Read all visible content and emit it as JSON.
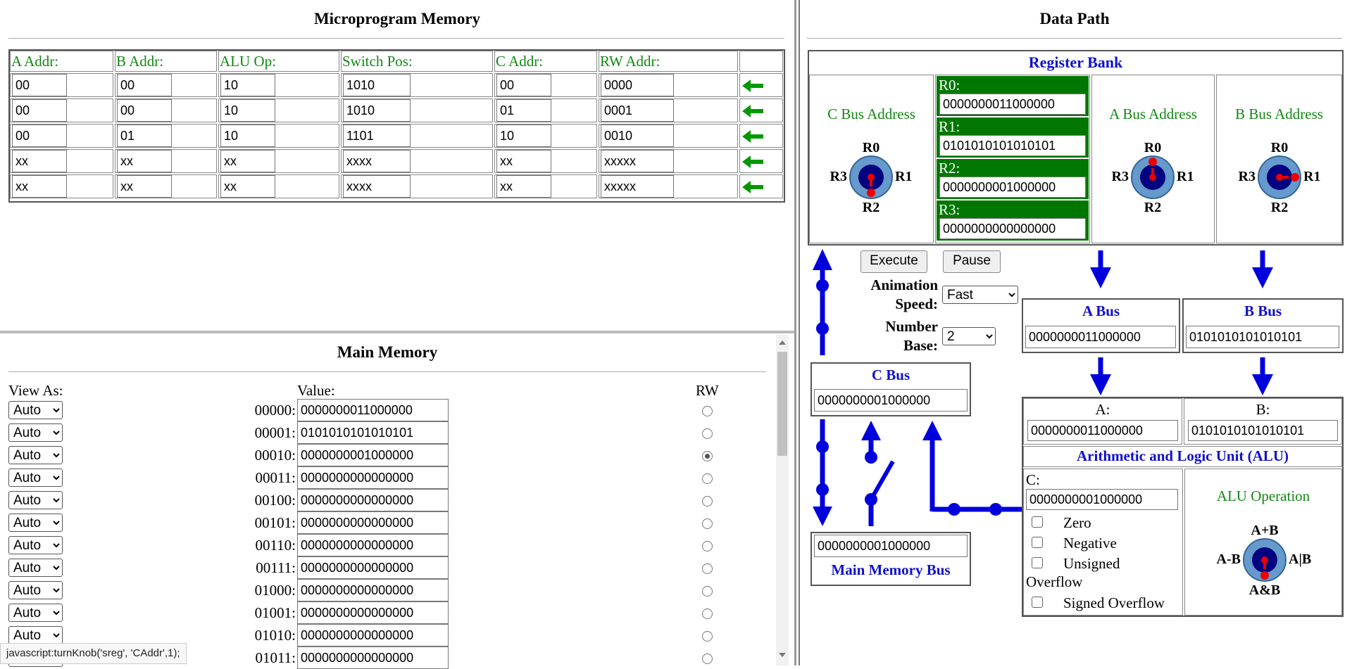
{
  "micro": {
    "title": "Microprogram Memory",
    "headers": [
      "A Addr:",
      "B Addr:",
      "ALU Op:",
      "Switch Pos:",
      "C Addr:",
      "RW Addr:"
    ],
    "rows": [
      [
        "00",
        "00",
        "10",
        "1010",
        "00",
        "0000"
      ],
      [
        "00",
        "00",
        "10",
        "1010",
        "01",
        "0001"
      ],
      [
        "00",
        "01",
        "10",
        "1101",
        "10",
        "0010"
      ],
      [
        "xx",
        "xx",
        "xx",
        "xxxx",
        "xx",
        "xxxxx"
      ],
      [
        "xx",
        "xx",
        "xx",
        "xxxx",
        "xx",
        "xxxxx"
      ]
    ],
    "arrow_color": "#009900"
  },
  "main": {
    "title": "Main Memory",
    "view_as_label": "View As:",
    "value_label": "Value:",
    "rw_label": "RW",
    "view_option": "Auto",
    "rows": [
      {
        "addr": "00000:",
        "value": "0000000011000000",
        "rw": false
      },
      {
        "addr": "00001:",
        "value": "0101010101010101",
        "rw": false
      },
      {
        "addr": "00010:",
        "value": "0000000001000000",
        "rw": true
      },
      {
        "addr": "00011:",
        "value": "0000000000000000",
        "rw": false
      },
      {
        "addr": "00100:",
        "value": "0000000000000000",
        "rw": false
      },
      {
        "addr": "00101:",
        "value": "0000000000000000",
        "rw": false
      },
      {
        "addr": "00110:",
        "value": "0000000000000000",
        "rw": false
      },
      {
        "addr": "00111:",
        "value": "0000000000000000",
        "rw": false
      },
      {
        "addr": "01000:",
        "value": "0000000000000000",
        "rw": false
      },
      {
        "addr": "01001:",
        "value": "0000000000000000",
        "rw": false
      },
      {
        "addr": "01010:",
        "value": "0000000000000000",
        "rw": false
      },
      {
        "addr": "01011:",
        "value": "0000000000000000",
        "rw": false
      }
    ],
    "status_bar": "javascript:turnKnob('sreg', 'CAddr',1);"
  },
  "datapath": {
    "title": "Data Path",
    "register_bank": {
      "title": "Register Bank",
      "c_bus_address": "C Bus Address",
      "a_bus_address": "A Bus Address",
      "b_bus_address": "B Bus Address",
      "registers": [
        {
          "label": "R0:",
          "value": "0000000011000000"
        },
        {
          "label": "R1:",
          "value": "0101010101010101"
        },
        {
          "label": "R2:",
          "value": "0000000001000000"
        },
        {
          "label": "R3:",
          "value": "0000000000000000"
        }
      ],
      "knob_labels": {
        "top": "R0",
        "right": "R1",
        "bottom": "R2",
        "left": "R3"
      }
    },
    "controls": {
      "execute": "Execute",
      "pause": "Pause",
      "speed_label_1": "Animation",
      "speed_label_2": "Speed:",
      "speed_value": "Fast",
      "base_label_1": "Number",
      "base_label_2": "Base:",
      "base_value": "2"
    },
    "a_bus": {
      "title": "A Bus",
      "value": "0000000011000000"
    },
    "b_bus": {
      "title": "B Bus",
      "value": "0101010101010101"
    },
    "c_bus": {
      "title": "C Bus",
      "value": "0000000001000000"
    },
    "mm_bus": {
      "title": "Main Memory Bus",
      "value": "0000000001000000"
    },
    "alu": {
      "a_label": "A:",
      "a_value": "0000000011000000",
      "b_label": "B:",
      "b_value": "0101010101010101",
      "title": "Arithmetic and Logic Unit (ALU)",
      "c_label": "C:",
      "c_value": "0000000001000000",
      "flags": [
        "Zero",
        "Negative",
        "Unsigned",
        "Overflow",
        "Signed Overflow"
      ],
      "op_title": "ALU Operation",
      "knob_labels": {
        "top": "A+B",
        "right": "A|B",
        "bottom": "A&B",
        "left": "A-B"
      }
    },
    "bus_color": "#0000dd"
  }
}
